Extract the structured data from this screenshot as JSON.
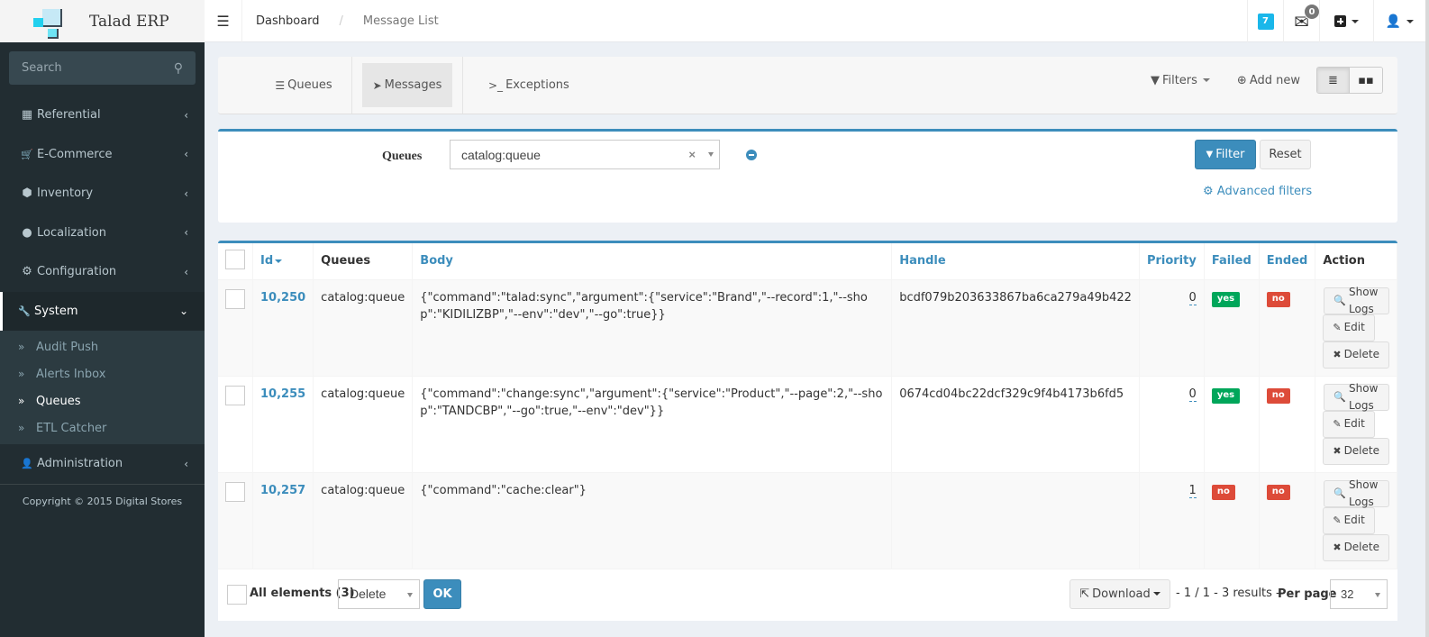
{
  "app": {
    "title": "Talad ERP"
  },
  "header": {
    "breadcrumb": [
      {
        "label": "Dashboard"
      },
      {
        "label": "Message List"
      }
    ],
    "notifications_count": "7",
    "messages_count": "0",
    "icons": {
      "menu": "hamburger-icon",
      "messages": "envelope-icon",
      "add": "plus-square-icon",
      "user": "user-icon"
    }
  },
  "sidebar": {
    "search_placeholder": "Search",
    "items": [
      {
        "label": "Referential",
        "icon": "grid-icon",
        "glyph": "▦",
        "arrow": "‹"
      },
      {
        "label": "E-Commerce",
        "icon": "cart-icon",
        "glyph": "🛒",
        "arrow": "‹"
      },
      {
        "label": "Inventory",
        "icon": "cubes-icon",
        "glyph": "⬢",
        "arrow": "‹"
      },
      {
        "label": "Localization",
        "icon": "globe-icon",
        "glyph": "●",
        "arrow": "‹"
      },
      {
        "label": "Configuration",
        "icon": "cogs-icon",
        "glyph": "⚙",
        "arrow": "‹"
      },
      {
        "label": "System",
        "icon": "wrench-icon",
        "glyph": "🔧",
        "arrow": "⌄"
      }
    ],
    "system_submenu": [
      {
        "label": "Audit Push"
      },
      {
        "label": "Alerts Inbox"
      },
      {
        "label": "Queues"
      },
      {
        "label": "ETL Catcher"
      }
    ],
    "admin": {
      "label": "Administration",
      "icon": "user-icon",
      "arrow": "‹"
    },
    "copyright": "Copyright © 2015 Digital Stores"
  },
  "tabs": {
    "items": [
      {
        "label": "Queues"
      },
      {
        "label": "Messages"
      },
      {
        "label": "Exceptions"
      }
    ],
    "active": "Messages",
    "filters_label": "Filters",
    "add_new_label": "Add new"
  },
  "filter": {
    "label": "Queues",
    "value": "catalog:queue",
    "filter_button": "Filter",
    "reset_button": "Reset",
    "advanced_link": "Advanced filters"
  },
  "table": {
    "columns": [
      "Id",
      "Queues",
      "Body",
      "Handle",
      "Priority",
      "Failed",
      "Ended",
      "Action"
    ],
    "rows": [
      {
        "id": "10,250",
        "queue": "catalog:queue",
        "body": "{\"command\":\"talad:sync\",\"argument\":{\"service\":\"Brand\",\"--record\":1,\"--shop\":\"KIDILIZBP\",\"--env\":\"dev\",\"--go\":true}}",
        "handle": "bcdf079b203633867ba6ca279a49b422",
        "priority": "0",
        "failed": "yes",
        "ended": "no"
      },
      {
        "id": "10,255",
        "queue": "catalog:queue",
        "body": "{\"command\":\"change:sync\",\"argument\":{\"service\":\"Product\",\"--page\":2,\"--shop\":\"TANDCBP\",\"--go\":true,\"--env\":\"dev\"}}",
        "handle": "0674cd04bc22dcf329c9f4b4173b6fd5",
        "priority": "0",
        "failed": "yes",
        "ended": "no"
      },
      {
        "id": "10,257",
        "queue": "catalog:queue",
        "body": "{\"command\":\"cache:clear\"}",
        "handle": "",
        "priority": "1",
        "failed": "no",
        "ended": "no"
      }
    ],
    "actions": {
      "show_logs": "Show Logs",
      "edit": "Edit",
      "delete": "Delete"
    }
  },
  "footer": {
    "all_elements": "All elements (3)",
    "batch_action": "Delete",
    "ok_button": "OK",
    "download": "Download",
    "pager": "- 1 / 1 - 3 results -",
    "per_page_label": "Per page",
    "per_page_value": "32"
  },
  "colors": {
    "primary": "#3c8dbc",
    "success": "#00a65a",
    "danger": "#dd4b39",
    "sidebar_bg": "#222d32",
    "badge": "#1ab7ea"
  }
}
